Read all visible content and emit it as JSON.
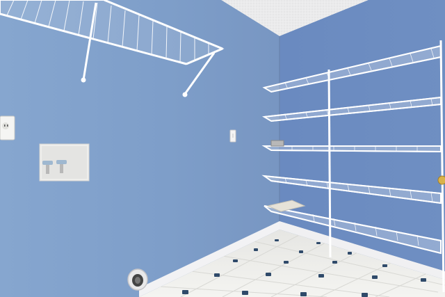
{
  "scene": {
    "room_type": "laundry room",
    "colors": {
      "left_wall": "#7f9fca",
      "right_wall": "#6f8ec0",
      "ceiling": "#e9e9ea",
      "baseboard": "#f2f2f4",
      "floor_tile": "#eeeeea",
      "floor_dot": "#2f4a6a",
      "shelf_wire": "#ffffff"
    },
    "icons": {
      "outlet": "electrical-outlet-icon",
      "switch": "light-switch-icon",
      "valves": "washer-valve-icon",
      "drain": "floor-drain-icon",
      "door_knob": "door-knob-icon"
    }
  }
}
